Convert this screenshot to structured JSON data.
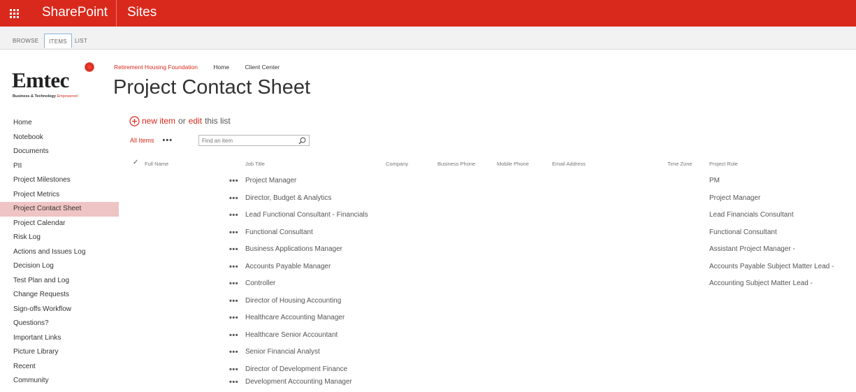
{
  "suitebar": {
    "app_name": "SharePoint",
    "section": "Sites",
    "waffle_icon": "app-launcher-icon"
  },
  "ribbon": {
    "tabs": [
      {
        "label": "BROWSE"
      },
      {
        "label": "ITEMS"
      },
      {
        "label": "LIST"
      }
    ]
  },
  "logo": {
    "name": "Emtec",
    "tagline_prefix": "Business & Technology ",
    "tagline_accent": "Empowered"
  },
  "topnav": {
    "site": "Retirement Housing Foundation",
    "links": [
      "Home",
      "Client Center"
    ]
  },
  "page_title": "Project Contact Sheet",
  "leftnav": {
    "items": [
      {
        "label": "Home"
      },
      {
        "label": "Notebook"
      },
      {
        "label": "Documents"
      },
      {
        "label": "PII"
      },
      {
        "label": "Project Milestones"
      },
      {
        "label": "Project Metrics"
      },
      {
        "label": "Project Contact Sheet",
        "selected": true
      },
      {
        "label": "Project Calendar"
      },
      {
        "label": "Risk Log"
      },
      {
        "label": "Actions and Issues Log"
      },
      {
        "label": "Decision Log"
      },
      {
        "label": "Test Plan and Log"
      },
      {
        "label": "Change Requests"
      },
      {
        "label": "Sign-offs Workflow"
      },
      {
        "label": "Questions?"
      },
      {
        "label": "Important Links"
      },
      {
        "label": "Picture Library"
      },
      {
        "label": "Recent"
      },
      {
        "label": "Community"
      }
    ]
  },
  "commands": {
    "new_item": "new item",
    "or_text": "or",
    "edit": "edit",
    "this_list": "this list",
    "all_items": "All Items",
    "more": "•••",
    "search_placeholder": "Find an item"
  },
  "list": {
    "columns": [
      {
        "label": "Full Name"
      },
      {
        "label": "Job Title"
      },
      {
        "label": "Company"
      },
      {
        "label": "Business Phone"
      },
      {
        "label": "Mobile Phone"
      },
      {
        "label": "Email Address"
      },
      {
        "label": "Time Zone"
      },
      {
        "label": "Project Role"
      }
    ],
    "rows": [
      {
        "job_title": "Project Manager",
        "project_role": "PM"
      },
      {
        "job_title": "Director, Budget & Analytics",
        "project_role": "Project Manager"
      },
      {
        "job_title": "Lead Functional Consultant - Financials",
        "project_role": "Lead Financials Consultant"
      },
      {
        "job_title": "Functional Consultant",
        "project_role": "Functional Consultant"
      },
      {
        "job_title": "Business Applications Manager",
        "project_role": "Assistant Project Manager -"
      },
      {
        "job_title": "Accounts Payable Manager",
        "project_role": "Accounts Payable Subject Matter Lead -"
      },
      {
        "job_title": "Controller",
        "project_role": "Accounting Subject Matter Lead -"
      },
      {
        "job_title": "Director of Housing Accounting",
        "project_role": ""
      },
      {
        "job_title": "Healthcare Accounting Manager",
        "project_role": ""
      },
      {
        "job_title": "Healthcare Senior Accountant",
        "project_role": ""
      },
      {
        "job_title": "Senior Financial Analyst",
        "project_role": ""
      },
      {
        "job_title": "Director of Development Finance",
        "project_role": ""
      },
      {
        "job_title": "Development Accounting Manager",
        "project_role": ""
      }
    ],
    "row_ellipsis": "•••"
  },
  "colors": {
    "brand_red": "#d9291c",
    "selected_nav": "#efc4c4"
  }
}
